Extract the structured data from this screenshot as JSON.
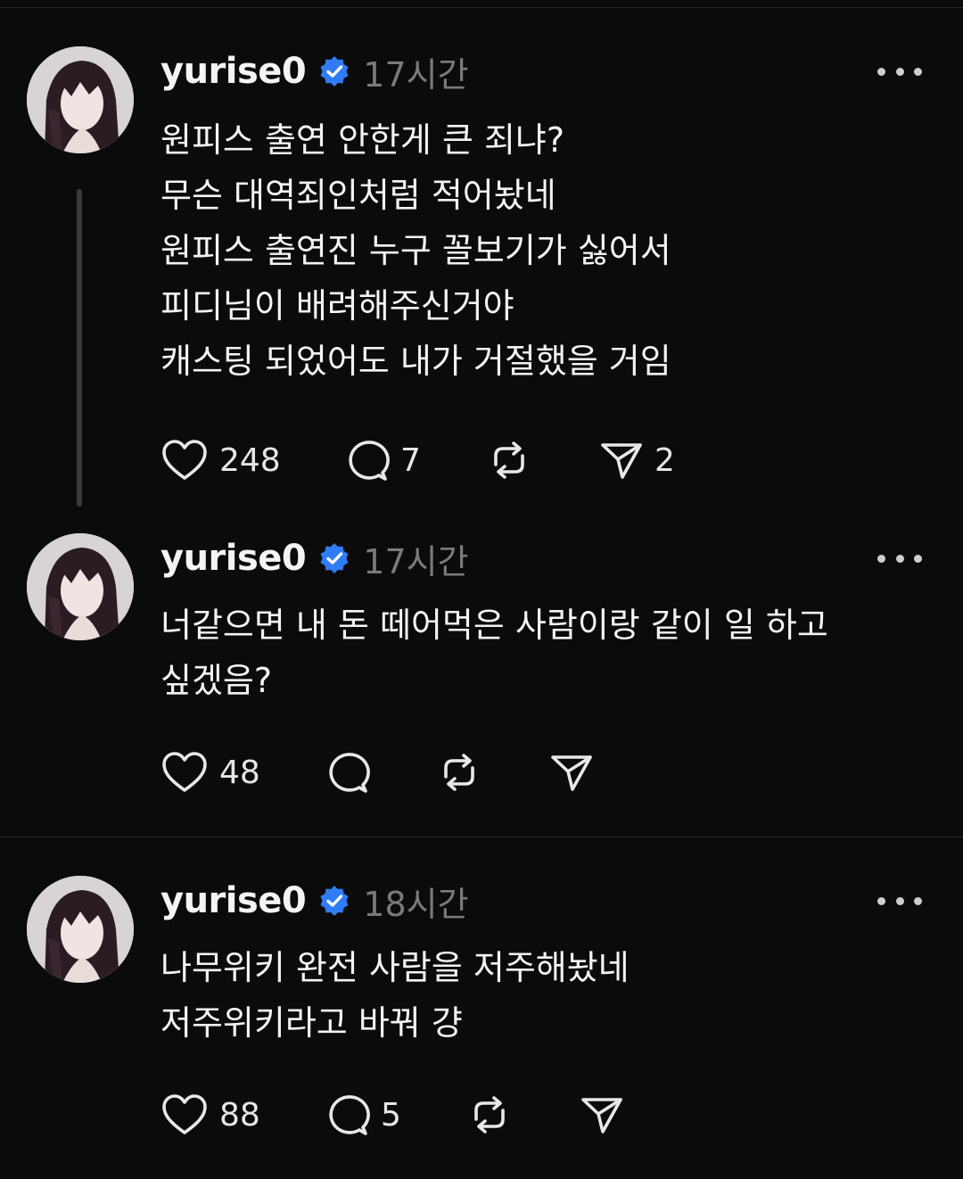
{
  "posts": [
    {
      "username": "yurise0",
      "timestamp": "17시간",
      "lines": [
        "원피스 출연 안한게 큰 죄냐?",
        "무슨 대역죄인처럼 적어놨네",
        "원피스 출연진 누구 꼴보기가 싫어서",
        "피디님이 배려해주신거야",
        "캐스팅 되었어도 내가 거절했을 거임"
      ],
      "likes": "248",
      "replies": "7",
      "reposts": "",
      "shares": "2"
    },
    {
      "username": "yurise0",
      "timestamp": "17시간",
      "lines": [
        "너같으면 내 돈 떼어먹은 사람이랑 같이 일 하고",
        "싶겠음?"
      ],
      "likes": "48",
      "replies": "",
      "reposts": "",
      "shares": ""
    },
    {
      "username": "yurise0",
      "timestamp": "18시간",
      "lines": [
        "나무위키 완전 사람을 저주해놨네",
        "저주위키라고 바꿔 걍"
      ],
      "likes": "88",
      "replies": "5",
      "reposts": "",
      "shares": ""
    }
  ],
  "colors": {
    "background": "#0b0b0b",
    "text": "#f3f3f3",
    "muted": "#7a7a7a",
    "verified": "#2f7cf6"
  }
}
